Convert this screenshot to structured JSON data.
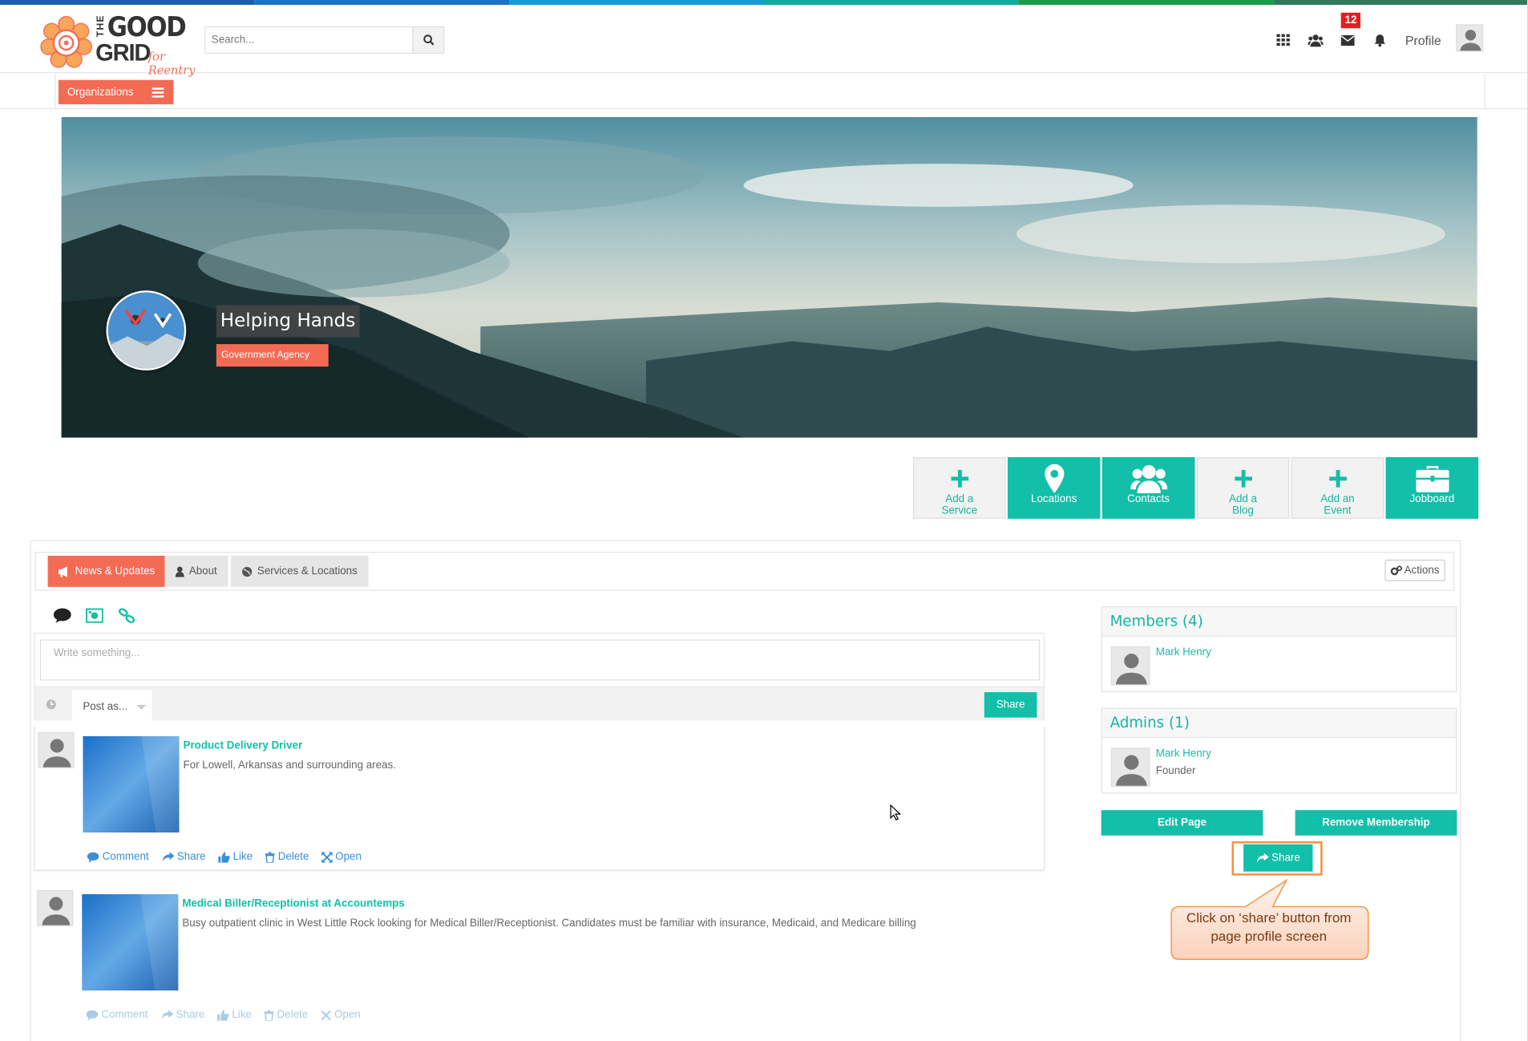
{
  "colors": {
    "teal": "#12bfa8",
    "coral": "#f46b55",
    "stripe": [
      "#1a5fa8",
      "#1e73c4",
      "#1a9bd1",
      "#12a89c",
      "#1d9a4a",
      "#2e7a5a"
    ]
  },
  "header": {
    "logo": {
      "the": "THE",
      "good": "GOOD",
      "grid": "GRID",
      "tagline": "for Reentry"
    },
    "search": {
      "placeholder": "Search..."
    },
    "notification_count": "12",
    "profile_label": "Profile",
    "icons": [
      "apps-grid-icon",
      "people-icon",
      "mail-icon",
      "bell-icon"
    ]
  },
  "subbar": {
    "organizations_label": "Organizations"
  },
  "org": {
    "name": "Helping Hands",
    "type": "Government Agency"
  },
  "action_buttons": [
    {
      "label1": "Add a",
      "label2": "Service",
      "icon": "plus-icon"
    },
    {
      "label1": "Locations",
      "label2": "",
      "icon": "map-marker-icon"
    },
    {
      "label1": "Contacts",
      "label2": "",
      "icon": "group-icon"
    },
    {
      "label1": "Add a",
      "label2": "Blog",
      "icon": "plus-icon"
    },
    {
      "label1": "Add an",
      "label2": "Event",
      "icon": "plus-icon"
    },
    {
      "label1": "Jobboard",
      "label2": "",
      "icon": "briefcase-icon"
    }
  ],
  "tabs": [
    {
      "label": "News & Updates",
      "icon": "megaphone-icon"
    },
    {
      "label": "About",
      "icon": "user-icon"
    },
    {
      "label": "Services & Locations",
      "icon": "globe-icon"
    }
  ],
  "actions_label": "Actions",
  "composer": {
    "placeholder": "Write something...",
    "post_as": "Post as...",
    "share_label": "Share"
  },
  "feed": [
    {
      "title": "Product Delivery Driver",
      "description": "For Lowell, Arkansas and surrounding areas."
    },
    {
      "title": "Medical Biller/Receptionist at Accountemps",
      "description": "Busy outpatient clinic in West Little Rock looking for Medical Biller/Receptionist. Candidates must be familiar with insurance, Medicaid, and Medicare billing"
    }
  ],
  "feed_actions": [
    "Comment",
    "Share",
    "Like",
    "Delete",
    "Open"
  ],
  "sidebar": {
    "members": {
      "title": "Members (4)",
      "name": "Mark Henry"
    },
    "admins": {
      "title": "Admins (1)",
      "name": "Mark Henry",
      "role": "Founder"
    },
    "edit_page": "Edit Page",
    "remove_membership": "Remove Membership",
    "share_label": "Share"
  },
  "callout": {
    "line1": "Click on ‘share’ button from",
    "line2": "page profile screen"
  }
}
